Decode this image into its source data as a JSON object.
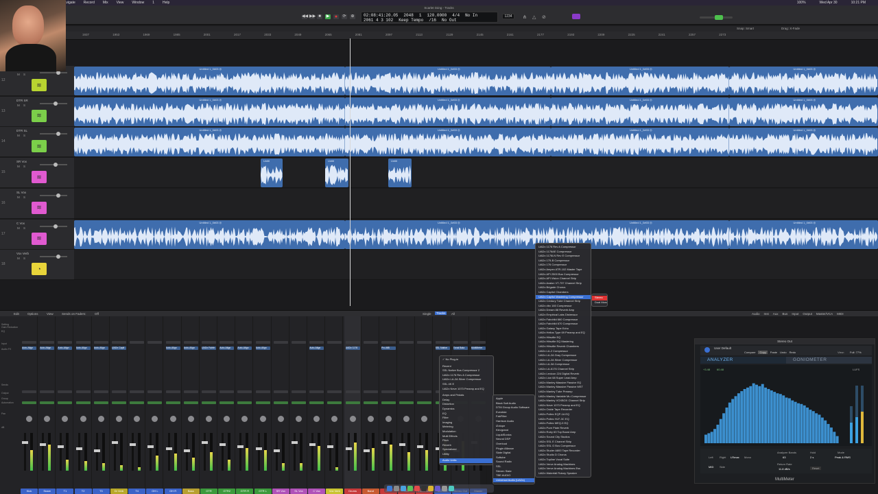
{
  "menubar": {
    "items": [
      "Navigate",
      "Record",
      "Mix",
      "View",
      "Window",
      "1",
      "Help"
    ],
    "status": [
      "100%",
      "Wed Apr 30",
      "10:21 PM"
    ]
  },
  "window": {
    "title": "Scarlet rising - Tracks"
  },
  "lcd": {
    "position": "02:08:41:20.05",
    "bars": "2048",
    "beat": "1",
    "bars2": "2061  4  3  102",
    "tempo": "120.0000",
    "tempo_label": "Keep Tempo",
    "signature": "4/4",
    "division": "/16",
    "in": "No In",
    "out": "No Out"
  },
  "snap": {
    "label": "Snap:",
    "value": "Smart",
    "drag_label": "Drag:",
    "drag_value": "X-Fade"
  },
  "ruler": [
    "1937",
    "1953",
    "1969",
    "1985",
    "2001",
    "2017",
    "2033",
    "2049",
    "2065",
    "2081",
    "2097",
    "2113",
    "2129",
    "2145",
    "2161",
    "2177",
    "2193",
    "2209",
    "2225",
    "2241",
    "2257",
    "2273"
  ],
  "tracks": [
    {
      "num": "12",
      "name": "",
      "color": "#b8d430",
      "icon": "≋",
      "regions": [
        {
          "label": "Untitled 1_0#03 ◎"
        },
        {
          "label": "Untitled 1_0#03 ◎"
        },
        {
          "label": "Untitled 1_0#03 ◎"
        },
        {
          "label": "Untitled 1_0#03 ◎"
        }
      ]
    },
    {
      "num": "13",
      "name": "DTR SR",
      "color": "#7bcf4a",
      "icon": "≋",
      "regions": [
        {
          "label": "Untitled 1_0#03 ◎"
        },
        {
          "label": "Untitled 1_0#03 ◎"
        },
        {
          "label": "Untitled 1_0#03 ◎"
        },
        {
          "label": "Untitled 1_0#03 ◎"
        }
      ]
    },
    {
      "num": "14",
      "name": "DTR SL",
      "color": "#7bcf4a",
      "icon": "≋",
      "regions": [
        {
          "label": "Untitled 1_0#03 ◎"
        },
        {
          "label": "Untitled 1_0#03 ◎"
        },
        {
          "label": "Untitled 1_0#03 ◎"
        },
        {
          "label": "Untitled 1_0#03 ◎"
        }
      ]
    },
    {
      "num": "15",
      "name": "SR Vox",
      "color": "#e05ad0",
      "icon": "≋",
      "regions": [
        {
          "label": "Untitl"
        },
        {
          "label": "Untitl"
        },
        {
          "label": "Untitl"
        }
      ]
    },
    {
      "num": "16",
      "name": "SL Vox",
      "color": "#e05ad0",
      "icon": "≋",
      "regions": []
    },
    {
      "num": "17",
      "name": "C Vox",
      "color": "#e05ad0",
      "icon": "≋",
      "regions": [
        {
          "label": "Untitled 1_0#03 ◎"
        },
        {
          "label": "Untitled 1_0#03 ◎"
        },
        {
          "label": "Untitled 1_0#03 ◎"
        },
        {
          "label": "Untitled 1_0#03 ◎"
        }
      ]
    },
    {
      "num": "18",
      "name": "Vox Verb",
      "color": "#e8d43a",
      "icon": "◔",
      "regions": []
    }
  ],
  "mixer_bar": {
    "edit": "Edit",
    "options": "Options",
    "view": "View",
    "sends": "Sends on Faders:",
    "sends_value": "Off",
    "single": "Single",
    "tracks": "Tracks",
    "all": "All",
    "filters": [
      "Audio",
      "Inst",
      "Aux",
      "Bus",
      "Input",
      "Output",
      "Master/VCA",
      "MIDI"
    ]
  },
  "mixer_labels": [
    "Setting",
    "Gain Reduction",
    "EQ",
    "Input",
    "Audio FX",
    "Sends",
    "Output",
    "Group",
    "Automation",
    "Pan",
    "dB"
  ],
  "strips": [
    {
      "label": "Kick",
      "color": "#3b63c8",
      "plugin": "Auto-Align",
      "level": 0.55
    },
    {
      "label": "Snare",
      "color": "#3b63c8",
      "plugin": "Auto-Align",
      "level": 0.7
    },
    {
      "label": "T1",
      "color": "#3b63c8",
      "plugin": "Auto-Align",
      "level": 0.3
    },
    {
      "label": "T2",
      "color": "#3b63c8",
      "plugin": "Auto-Align",
      "level": 0.25
    },
    {
      "label": "T3",
      "color": "#3b63c8",
      "plugin": "Auto-Align",
      "level": 0.2
    },
    {
      "label": "Dr Verb",
      "color": "#b8a829",
      "plugin": "UADx Capit",
      "level": 0.15
    },
    {
      "label": "T4",
      "color": "#3b63c8",
      "plugin": "",
      "level": 0.1
    },
    {
      "label": "OH L",
      "color": "#3b63c8",
      "plugin": "",
      "level": 0.4
    },
    {
      "label": "OH R",
      "color": "#3b63c8",
      "plugin": "Auto-Align",
      "level": 0.45
    },
    {
      "label": "Bass",
      "color": "#b7a030",
      "plugin": "Auto-Align",
      "level": 0.35
    },
    {
      "label": "GTR",
      "color": "#3c9a3c",
      "plugin": "UADx Fairfe",
      "level": 0.5
    },
    {
      "label": "GTR2",
      "color": "#3c9a3c",
      "plugin": "Auto-Align",
      "level": 0.3
    },
    {
      "label": "GTR R",
      "color": "#3c9a3c",
      "plugin": "Auto-Align",
      "level": 0.6
    },
    {
      "label": "GTR L",
      "color": "#3c9a3c",
      "plugin": "Auto-Align",
      "level": 0.55
    },
    {
      "label": "SR Vox",
      "color": "#b052b8",
      "plugin": "",
      "level": 0.2
    },
    {
      "label": "SL Vox",
      "color": "#b052b8",
      "plugin": "",
      "level": 0.2
    },
    {
      "label": "C Vox",
      "color": "#b052b8",
      "plugin": "Auto-Align",
      "level": 0.65
    },
    {
      "label": "Vox Verb",
      "color": "#c9c430",
      "plugin": "",
      "level": 0.1
    },
    {
      "label": "Drums",
      "color": "#c83a3a",
      "plugin": "UADx 1176",
      "level": 0.75
    },
    {
      "label": "Band",
      "color": "#c85a30",
      "plugin": "",
      "level": 0.6
    },
    {
      "label": "GTR",
      "color": "#c83a3a",
      "plugin": "Pro-MB",
      "level": 0.7
    },
    {
      "label": "Vox",
      "color": "#c83a3a",
      "plugin": "",
      "level": 0.5
    },
    {
      "label": "Instrument",
      "color": "#c83a3a",
      "plugin": "",
      "level": 0.55
    },
    {
      "label": "Mix Bus",
      "color": "#3b63c8",
      "plugin": "SSL Native",
      "level": 0.8
    },
    {
      "label": "Stereo Out",
      "color": "#3b63c8",
      "plugin": "Tonal Bala",
      "level": 0.78
    },
    {
      "label": "Master",
      "color": "#3b63c8",
      "plugin": "MultiMeter",
      "level": 0.0
    }
  ],
  "menu_main": [
    "✓ No Plug-in",
    "",
    "Recent",
    "SSL Native Bus Compressor 2",
    "UADx 1176 Rev A Compressor",
    "UADx LA-2A Silver Compressor",
    "SSL 4K E",
    "UADx Neve 1073 Preamp and EQ",
    "",
    "Amps and Pedals",
    "Delay",
    "Distortion",
    "Dynamics",
    "EQ",
    "Filter",
    "Imaging",
    "Metering",
    "Modulation",
    "Multi Effects",
    "Pitch",
    "Reverb",
    "Specialized",
    "Utility",
    "",
    "Audio Units"
  ],
  "menu_vendors": [
    "Apple",
    "Black Salt Audio",
    "DTM Group Audio Software",
    "Eventide",
    "FabFilter",
    "Harrison Audio",
    "iZotope",
    "Klevgrand",
    "LiquidSonics",
    "Neural DSP",
    "Overloud",
    "Plugin Alliance",
    "Slate Digital",
    "Softube",
    "Sound Radix",
    "SSL",
    "Steven Slate",
    "TBE AUDIO",
    "Universal Audio (UADx)"
  ],
  "menu_uad": [
    "UADx 1176 Rev A Compressor",
    "UADx 1176AE Compressor",
    "UADx 1176LN Rev E Compressor",
    "UADx 175-B Compressor",
    "UADx 176 Compressor",
    "UADx Ampex ATR-102 Master Tape",
    "UADx API 2500 Bus Compressor",
    "UADx API Vision Channel Strip",
    "UADx Avalon VT-737 Channel Strip",
    "UADx Brigade Chorus",
    "UADx Capitol Chambers",
    "UADx Capitol Mastering Compressor",
    "UADx Century Tube Channel Strip",
    "UADx dbx 160 Compressor",
    "UADx Dream 88 Reverb Amp",
    "UADx Empirical Labs Distressor",
    "UADx Fairchild 660 Compressor",
    "UADx Fairchild 670 Compressor",
    "UADx Galaxy Tape Echo",
    "UADx Helios Type 69 Preamp and EQ",
    "UADx Hitsville EQ",
    "UADx Hitsville EQ Mastering",
    "UADx Hitsville Reverb Chambers",
    "UADx LA-2 Compressor",
    "UADx LA-2A Gray Compressor",
    "UADx LA-2A Silver Compressor",
    "UADx LA-3A Compressor",
    "UADx LA-6176 Channel Strip",
    "UADx Lexicon 224 Digital Reverb",
    "UADx Lion 68 Super Lead Amp",
    "UADx Manley Massive Passive EQ",
    "UADx Manley Massive Passive MST",
    "UADx Manley Tube Preamp",
    "UADx Manley Variable Mu Compressor",
    "UADx Manley VOXBOX Channel Strip",
    "UADx Neve 1073 Preamp and EQ",
    "UADx Oxide Tape Recorder",
    "UADx Pultec EQP-1A EQ",
    "UADx Pultec HLF-3C EQ",
    "UADx Pultec MEQ-5 EQ",
    "UADx Pure Plate Reverb",
    "UADx Ruby 63 Top Boost Amp",
    "UADx Sound City Studios",
    "UADx SSL E Channel Strip",
    "UADx SSL G Bus Compressor",
    "UADx Studer A800 Tape Recorder",
    "UADx Studio D Chorus",
    "UADx Topline Vocal Suite",
    "UADx Verve Analog Machines",
    "UADx Verve Analog Machines Ess",
    "UADx Waterfall Rotary Speaker"
  ],
  "menu_stereo": [
    "Stereo",
    "Dual Mono"
  ],
  "multimeter": {
    "title": "Stereo Out",
    "preset": "User Default",
    "buttons": [
      "Compare",
      "Copy",
      "Paste",
      "Undo",
      "Redo"
    ],
    "view_label": "View:",
    "view_value": "Full: 77%",
    "tab_analyzer": "ANALYZER",
    "tab_gonio": "GONIOMETER",
    "peak_l": "+3.48",
    "peak_r": "60.48",
    "lufs_label": "LUFS",
    "ctrl_left": "Left",
    "ctrl_right": "Right",
    "ctrl_lrmax": "LRmax",
    "ctrl_mono": "Mono",
    "ctrl_mid": "MID",
    "ctrl_side": "Side",
    "analyzer_bands": "Analyzer Bands",
    "analyzer_bands_value": "63",
    "hold": "Hold",
    "hold_value": "2 s",
    "mode": "Mode",
    "mode_value": "Peak & RMS",
    "return_rate": "Return Rate",
    "return_rate_value": "11.8 dB/s",
    "reset": "Reset",
    "footer": "MultiMeter",
    "spectrum": [
      0.12,
      0.14,
      0.16,
      0.2,
      0.26,
      0.34,
      0.42,
      0.5,
      0.57,
      0.62,
      0.66,
      0.7,
      0.73,
      0.76,
      0.78,
      0.8,
      0.84,
      0.82,
      0.8,
      0.83,
      0.78,
      0.76,
      0.74,
      0.72,
      0.7,
      0.69,
      0.67,
      0.64,
      0.63,
      0.6,
      0.58,
      0.56,
      0.55,
      0.53,
      0.5,
      0.47,
      0.45,
      0.42,
      0.4,
      0.36,
      0.32,
      0.27,
      0.22,
      0.16,
      0.1
    ]
  }
}
